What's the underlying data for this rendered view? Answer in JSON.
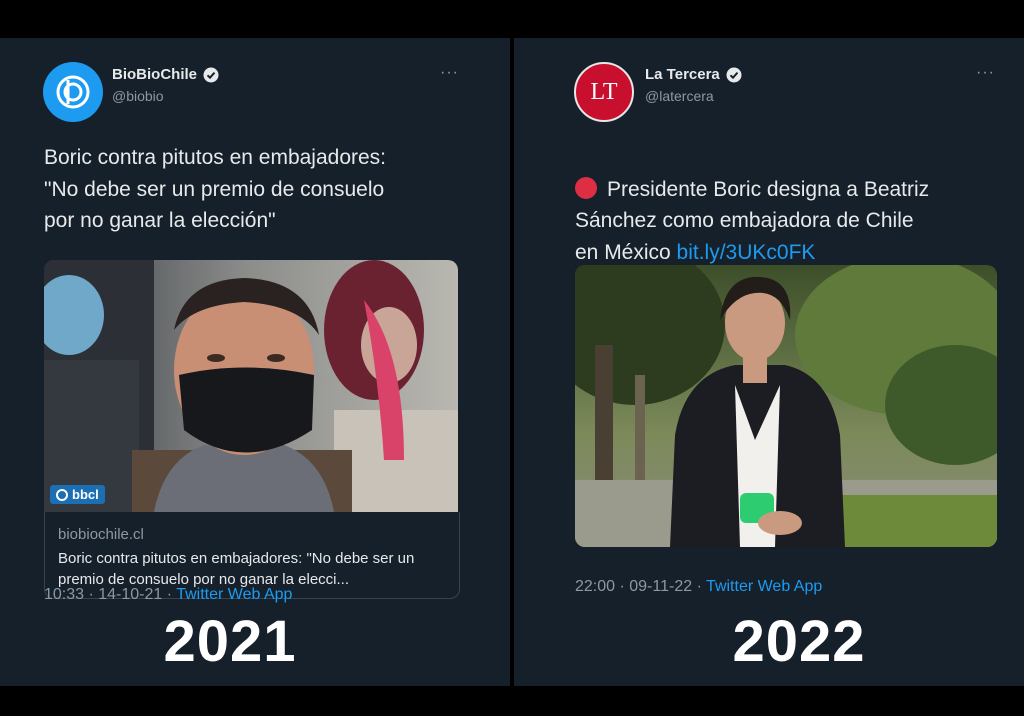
{
  "left": {
    "account_name": "BioBioChile",
    "handle": "@biobio",
    "more": "···",
    "text": "Boric contra pitutos en embajadores:\n\"No debe ser un premio de consuelo\npor no ganar la elección\"",
    "image_badge": "bbcl",
    "card_domain": "biobiochile.cl",
    "card_title": "Boric contra pitutos en embajadores: \"No debe ser un premio de consuelo por no ganar la elecci...",
    "timestamp": "10:33 · 14-10-21 · ",
    "app": "Twitter Web App",
    "year": "2021",
    "avatar_icon": "biobio-logo-icon",
    "brand_color": "#1da1f2"
  },
  "right": {
    "account_name": "La Tercera",
    "handle": "@latercera",
    "more": "···",
    "avatar_text": "LT",
    "text_prefix": "Presidente Boric designa a Beatriz\nSánchez como embajadora de Chile\nen México ",
    "link": "bit.ly/3UKc0FK",
    "timestamp": "22:00 · 09-11-22 · ",
    "app": "Twitter Web App",
    "year": "2022",
    "emoji_icon": "red-circle-icon",
    "brand_color": "#c8102e"
  }
}
